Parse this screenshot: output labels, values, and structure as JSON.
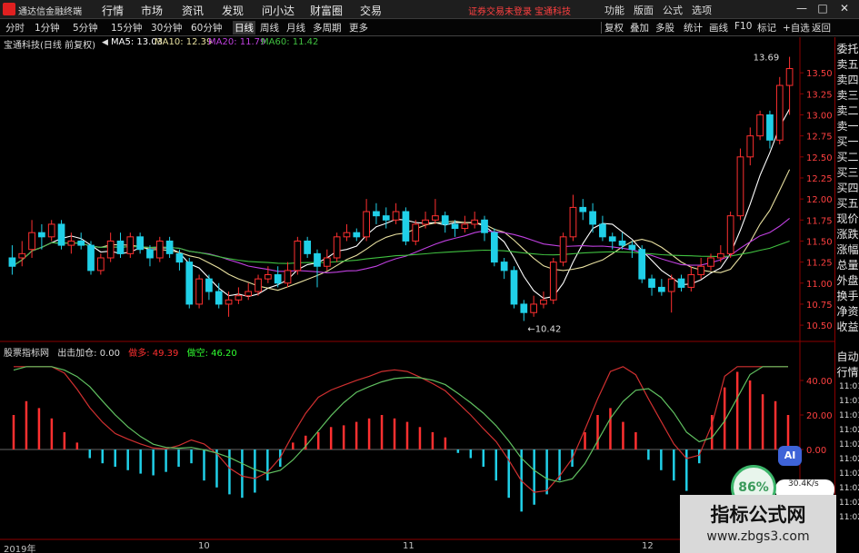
{
  "app": {
    "title": "通达信金融终端",
    "menus": [
      "行情",
      "市场",
      "资讯",
      "发现",
      "问小达",
      "财富圈",
      "交易"
    ],
    "notice": "证券交易未登录",
    "stock_short": "宝通科技",
    "right_menu": [
      "功能",
      "版面",
      "公式",
      "选项"
    ],
    "window_controls": [
      "—",
      "□",
      "✕"
    ]
  },
  "toolbar": {
    "periods": [
      "分时",
      "1分钟",
      "5分钟",
      "15分钟",
      "30分钟",
      "60分钟",
      "日线",
      "周线",
      "月线",
      "多周期",
      "更多"
    ],
    "active_period": "日线",
    "actions": [
      "复权",
      "叠加",
      "多股",
      "统计",
      "画线",
      "F10",
      "标记",
      "+自选",
      "返回"
    ]
  },
  "price_panel": {
    "stock_label": "宝通科技(日线 前复权)",
    "ma": [
      {
        "label": "MA5: 13.03",
        "color": "#ffffff"
      },
      {
        "label": "MA10: 12.39",
        "color": "#e8e0a0"
      },
      {
        "label": "MA20: 11.79",
        "color": "#c040e0"
      },
      {
        "label": "MA60: 11.42",
        "color": "#40c040"
      }
    ],
    "high_label": "13.69",
    "low_label": "10.42",
    "yaxis": [
      "13.50",
      "13.25",
      "13.00",
      "12.75",
      "12.50",
      "12.25",
      "12.00",
      "11.75",
      "11.50",
      "11.25",
      "11.00",
      "10.75",
      "10.50"
    ]
  },
  "indicator_panel": {
    "name": "股票指标网",
    "formula": "出击加仓: 0.00",
    "bull_label": "做多: 49.39",
    "bear_label": "做空: 46.20",
    "yaxis": [
      "40.00",
      "20.00",
      "0.00"
    ],
    "bull_color": "#ff3030",
    "bear_color": "#30ff30"
  },
  "date_labels": [
    "2019年",
    "10",
    "11",
    "12"
  ],
  "sidebar": {
    "items": [
      "委托",
      "卖五",
      "卖四",
      "卖三",
      "卖二",
      "卖一",
      "买一",
      "买二",
      "买三",
      "买四",
      "买五",
      "现价",
      "涨跌",
      "涨幅",
      "总量",
      "外盘",
      "换手",
      "净资",
      "收益"
    ],
    "times": [
      "11:01",
      "11:01",
      "11:01",
      "11:02",
      "11:02",
      "11:02",
      "11:02",
      "11:02",
      "11:02",
      "11:02"
    ],
    "auto_label": "自动",
    "quote_label": "行情"
  },
  "overlays": {
    "ai": "AI",
    "percent": "86%",
    "speed": "30.4K/s",
    "watermark_main": "指标公式网",
    "watermark_sub": "www.zbgs3.com"
  },
  "chart_data": [
    {
      "type": "candlestick",
      "title": "宝通科技(日线 前复权)",
      "ylim": [
        10.35,
        13.75
      ],
      "candles": [
        [
          11.3,
          11.2,
          11.45,
          11.1
        ],
        [
          11.3,
          11.35,
          11.5,
          11.2
        ],
        [
          11.4,
          11.6,
          11.75,
          11.3
        ],
        [
          11.6,
          11.55,
          11.7,
          11.4
        ],
        [
          11.55,
          11.7,
          11.75,
          11.5
        ],
        [
          11.7,
          11.45,
          11.75,
          11.4
        ],
        [
          11.45,
          11.5,
          11.6,
          11.35
        ],
        [
          11.5,
          11.45,
          11.6,
          11.4
        ],
        [
          11.45,
          11.15,
          11.5,
          11.1
        ],
        [
          11.15,
          11.3,
          11.35,
          11.1
        ],
        [
          11.3,
          11.5,
          11.6,
          11.25
        ],
        [
          11.5,
          11.35,
          11.6,
          11.3
        ],
        [
          11.35,
          11.55,
          11.6,
          11.3
        ],
        [
          11.55,
          11.4,
          11.6,
          11.35
        ],
        [
          11.4,
          11.3,
          11.45,
          11.2
        ],
        [
          11.3,
          11.5,
          11.55,
          11.25
        ],
        [
          11.5,
          11.35,
          11.55,
          11.3
        ],
        [
          11.35,
          11.25,
          11.4,
          11.15
        ],
        [
          11.25,
          10.75,
          11.3,
          10.7
        ],
        [
          10.75,
          11.05,
          11.1,
          10.7
        ],
        [
          11.05,
          10.9,
          11.1,
          10.8
        ],
        [
          10.9,
          10.75,
          11.0,
          10.7
        ],
        [
          10.75,
          10.8,
          10.9,
          10.6
        ],
        [
          10.8,
          10.85,
          10.95,
          10.75
        ],
        [
          10.85,
          10.9,
          11.0,
          10.8
        ],
        [
          10.9,
          11.05,
          11.1,
          10.85
        ],
        [
          11.05,
          11.1,
          11.2,
          11.0
        ],
        [
          11.1,
          11.0,
          11.2,
          10.95
        ],
        [
          11.0,
          11.15,
          11.25,
          10.95
        ],
        [
          11.15,
          11.5,
          11.55,
          11.1
        ],
        [
          11.5,
          11.35,
          11.55,
          11.3
        ],
        [
          11.35,
          11.2,
          11.4,
          10.95
        ],
        [
          11.2,
          11.3,
          11.4,
          11.15
        ],
        [
          11.3,
          11.55,
          11.6,
          11.25
        ],
        [
          11.55,
          11.6,
          11.7,
          11.5
        ],
        [
          11.6,
          11.55,
          11.65,
          11.5
        ],
        [
          11.55,
          11.85,
          12.0,
          11.5
        ],
        [
          11.85,
          11.8,
          11.95,
          11.7
        ],
        [
          11.8,
          11.75,
          11.9,
          11.65
        ],
        [
          11.75,
          11.85,
          11.95,
          11.7
        ],
        [
          11.85,
          11.5,
          11.9,
          11.45
        ],
        [
          11.5,
          11.7,
          11.75,
          11.45
        ],
        [
          11.7,
          11.75,
          11.85,
          11.65
        ],
        [
          11.75,
          11.8,
          12.0,
          11.7
        ],
        [
          11.8,
          11.7,
          11.85,
          11.6
        ],
        [
          11.7,
          11.65,
          11.75,
          11.55
        ],
        [
          11.65,
          11.7,
          11.8,
          11.6
        ],
        [
          11.7,
          11.75,
          11.85,
          11.65
        ],
        [
          11.75,
          11.6,
          11.8,
          11.5
        ],
        [
          11.6,
          11.25,
          11.65,
          11.2
        ],
        [
          11.25,
          11.15,
          11.3,
          11.05
        ],
        [
          11.15,
          10.75,
          11.2,
          10.7
        ],
        [
          10.75,
          10.65,
          10.8,
          10.55
        ],
        [
          10.65,
          10.75,
          10.85,
          10.6
        ],
        [
          10.75,
          10.8,
          10.9,
          10.7
        ],
        [
          10.8,
          11.25,
          11.3,
          10.75
        ],
        [
          11.25,
          11.55,
          11.6,
          11.2
        ],
        [
          11.55,
          11.9,
          12.05,
          11.5
        ],
        [
          11.9,
          11.85,
          12.0,
          11.75
        ],
        [
          11.85,
          11.7,
          11.95,
          11.6
        ],
        [
          11.7,
          11.55,
          11.8,
          11.5
        ],
        [
          11.55,
          11.5,
          11.6,
          11.4
        ],
        [
          11.5,
          11.45,
          11.6,
          11.4
        ],
        [
          11.45,
          11.4,
          11.5,
          11.3
        ],
        [
          11.4,
          11.05,
          11.45,
          11.0
        ],
        [
          11.05,
          10.95,
          11.1,
          10.85
        ],
        [
          10.95,
          10.9,
          11.05,
          10.85
        ],
        [
          10.9,
          11.05,
          11.1,
          10.65
        ],
        [
          11.05,
          10.95,
          11.1,
          10.9
        ],
        [
          10.95,
          11.1,
          11.2,
          10.9
        ],
        [
          11.1,
          11.2,
          11.3,
          11.05
        ],
        [
          11.2,
          11.3,
          11.35,
          11.15
        ],
        [
          11.3,
          11.35,
          11.45,
          11.25
        ],
        [
          11.35,
          11.8,
          11.85,
          11.3
        ],
        [
          11.8,
          12.5,
          12.6,
          11.75
        ],
        [
          12.5,
          12.75,
          12.85,
          12.4
        ],
        [
          12.75,
          13.0,
          13.05,
          12.7
        ],
        [
          13.0,
          12.7,
          13.05,
          12.6
        ],
        [
          12.7,
          13.35,
          13.45,
          12.65
        ],
        [
          13.35,
          13.55,
          13.69,
          13.0
        ]
      ],
      "ma_lines": [
        "MA5",
        "MA10",
        "MA20",
        "MA60"
      ]
    },
    {
      "type": "bar",
      "title": "股票指标网",
      "values": [
        20,
        28,
        24,
        18,
        10,
        4,
        -5,
        -8,
        -10,
        -12,
        -14,
        -15,
        -13,
        -10,
        -8,
        -18,
        -22,
        -26,
        -28,
        -25,
        -18,
        -10,
        4,
        8,
        10,
        13,
        14,
        16,
        18,
        20,
        18,
        16,
        13,
        10,
        7,
        -2,
        -5,
        -10,
        -18,
        -28,
        -36,
        -32,
        -26,
        -18,
        -10,
        10,
        20,
        24,
        16,
        10,
        -6,
        -12,
        -18,
        -24,
        -8,
        20,
        36,
        45,
        40,
        32,
        28,
        20
      ],
      "series": [
        {
          "name": "做多",
          "color": "#ff3030"
        },
        {
          "name": "做空",
          "color": "#30ff30"
        }
      ],
      "ylim": [
        -50,
        50
      ]
    }
  ]
}
